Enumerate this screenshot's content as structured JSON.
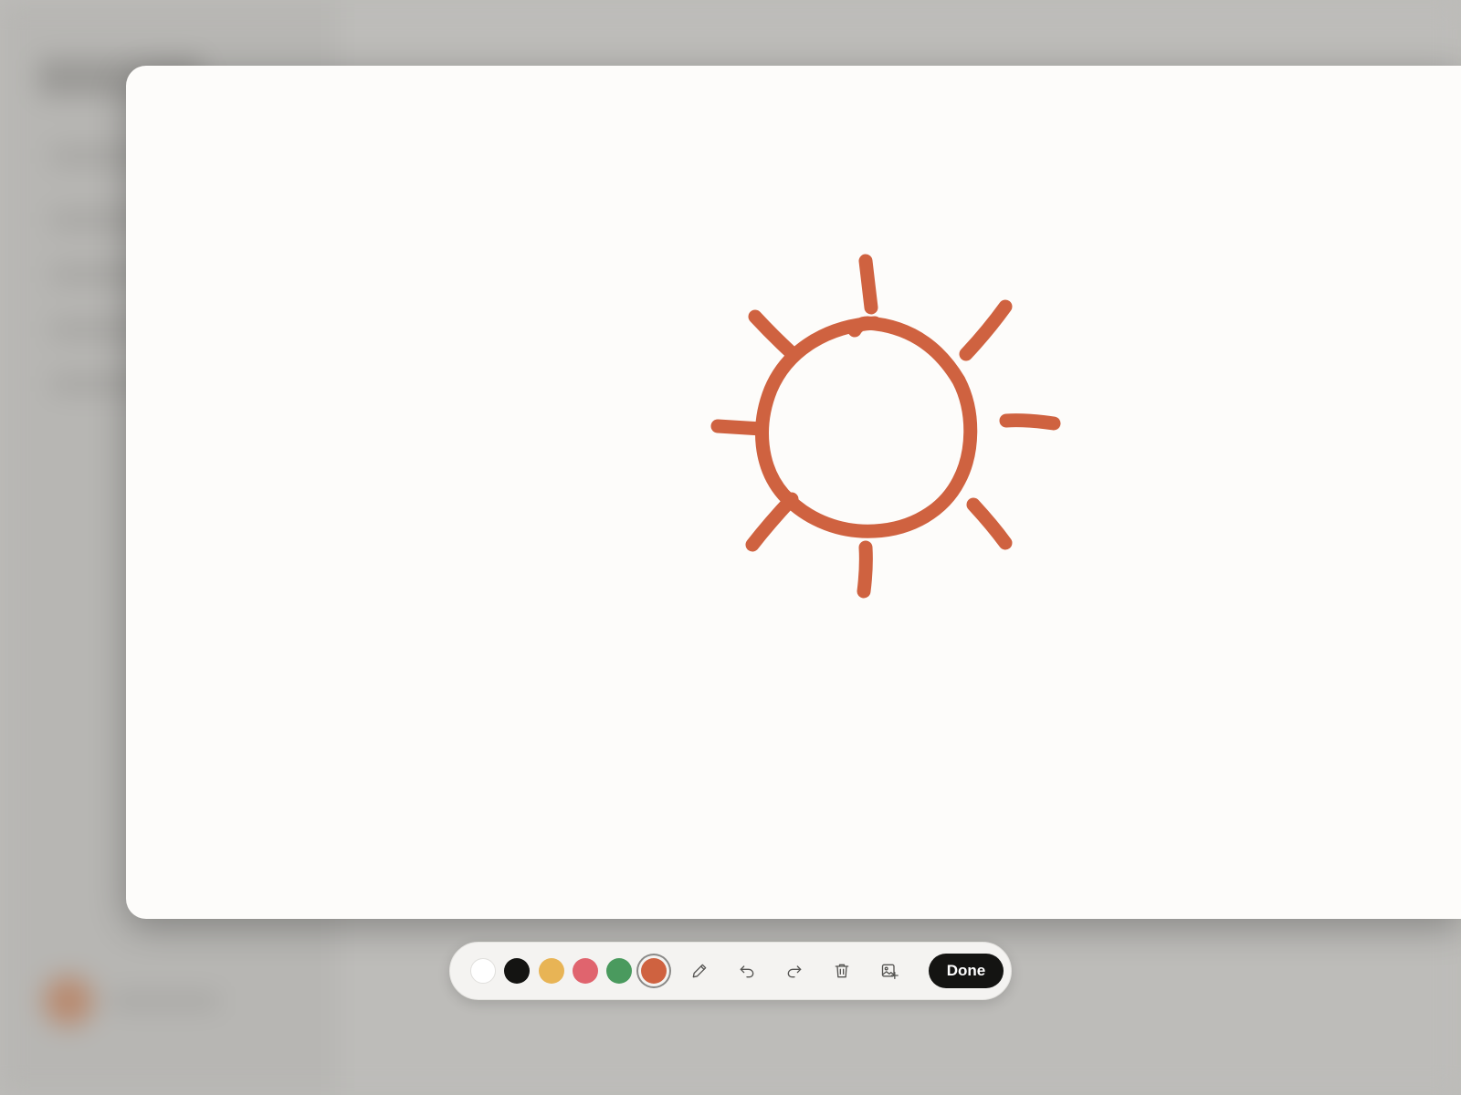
{
  "colors": {
    "stroke": "#cf6240",
    "toolbar_bg": "#f4f3f1",
    "canvas_bg": "#fdfcfa",
    "backdrop": "#bdbcb9"
  },
  "toolbar": {
    "swatches": [
      {
        "name": "white",
        "color": "#ffffff",
        "selected": false
      },
      {
        "name": "black",
        "color": "#141412",
        "selected": false
      },
      {
        "name": "yellow",
        "color": "#e8b455",
        "selected": false
      },
      {
        "name": "pink",
        "color": "#e0646e",
        "selected": false
      },
      {
        "name": "green",
        "color": "#4a9a5e",
        "selected": false
      },
      {
        "name": "orange",
        "color": "#cf6240",
        "selected": true
      }
    ],
    "tools": [
      {
        "name": "pencil",
        "icon": "pencil-icon"
      },
      {
        "name": "undo",
        "icon": "undo-icon"
      },
      {
        "name": "redo",
        "icon": "redo-icon"
      },
      {
        "name": "trash",
        "icon": "trash-icon"
      },
      {
        "name": "add-image",
        "icon": "image-plus-icon"
      }
    ],
    "done_label": "Done"
  },
  "drawing": {
    "subject": "sun-icon",
    "stroke_color": "#cf6240"
  }
}
